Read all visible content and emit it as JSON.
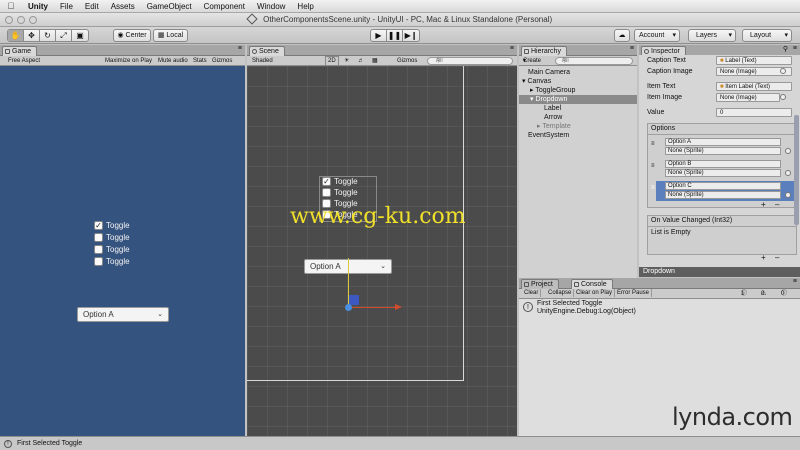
{
  "menubar": {
    "app": "Unity",
    "items": [
      "File",
      "Edit",
      "Assets",
      "GameObject",
      "Component",
      "Window",
      "Help"
    ]
  },
  "window": {
    "title": "OtherComponentsScene.unity - UnityUI - PC, Mac & Linux Standalone (Personal)"
  },
  "toolbar": {
    "center": "Center",
    "local": "Local",
    "account": "Account",
    "layers": "Layers",
    "layout": "Layout",
    "tool_icons": [
      "hand-icon",
      "move-icon",
      "rotate-icon",
      "scale-icon",
      "rect-icon"
    ]
  },
  "game": {
    "tab": "Game",
    "aspect": "Free Aspect",
    "options": [
      "Maximize on Play",
      "Mute audio",
      "Stats",
      "Gizmos"
    ],
    "toggles": [
      {
        "label": "Toggle",
        "checked": true
      },
      {
        "label": "Toggle",
        "checked": false
      },
      {
        "label": "Toggle",
        "checked": false
      },
      {
        "label": "Toggle",
        "checked": false
      }
    ],
    "dropdown": "Option A"
  },
  "scene": {
    "tab": "Scene",
    "shading": "Shaded",
    "mode2d": "2D",
    "gizmos": "Gizmos",
    "search_placeholder": "All",
    "toggles": [
      {
        "label": "Toggle",
        "checked": true
      },
      {
        "label": "Toggle",
        "checked": false
      },
      {
        "label": "Toggle",
        "checked": false
      },
      {
        "label": "Toggle",
        "checked": false
      }
    ],
    "dropdown": "Option A"
  },
  "hierarchy": {
    "tab": "Hierarchy",
    "create": "Create",
    "search_placeholder": "All",
    "items": [
      {
        "label": "Main Camera",
        "depth": 0
      },
      {
        "label": "Canvas",
        "depth": 0
      },
      {
        "label": "ToggleGroup",
        "depth": 1
      },
      {
        "label": "Dropdown",
        "depth": 1
      },
      {
        "label": "Label",
        "depth": 2
      },
      {
        "label": "Arrow",
        "depth": 2
      },
      {
        "label": "Template",
        "depth": 2
      },
      {
        "label": "EventSystem",
        "depth": 0
      }
    ]
  },
  "inspector": {
    "tab": "Inspector",
    "properties": [
      {
        "label": "Caption Text",
        "value": "Label (Text)"
      },
      {
        "label": "Caption Image",
        "value": "None (Image)"
      },
      {
        "label": "Item Text",
        "value": "Item Label (Text)"
      },
      {
        "label": "Item Image",
        "value": "None (Image)"
      },
      {
        "label": "Value",
        "value": "0"
      }
    ],
    "options_header": "Options",
    "options": [
      {
        "name": "Option A",
        "sprite": "None (Sprite)"
      },
      {
        "name": "Option B",
        "sprite": "None (Sprite)"
      },
      {
        "name": "Option C",
        "sprite": "None (Sprite)"
      }
    ],
    "event_header": "On Value Changed (Int32)",
    "event_body": "List is Empty",
    "footer": "Dropdown"
  },
  "console": {
    "tabs": [
      "Project",
      "Console"
    ],
    "buttons": [
      "Clear",
      "Collapse",
      "Clear on Play",
      "Error Pause"
    ],
    "counts": [
      "1",
      "0",
      "0"
    ],
    "entry_line1": "First Selected Toggle",
    "entry_line2": "UnityEngine.Debug:Log(Object)"
  },
  "status": {
    "message": "First Selected Toggle"
  },
  "watermark": "www.cg-ku.com",
  "brand": "lynda.com"
}
